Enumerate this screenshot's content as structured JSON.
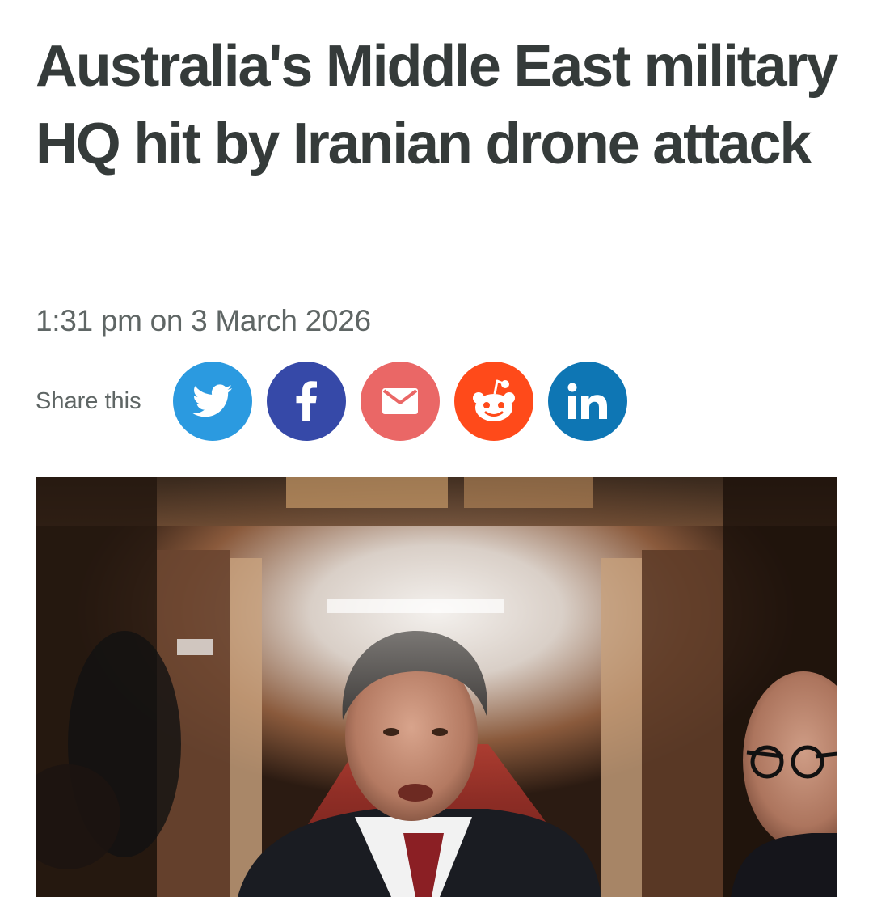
{
  "article": {
    "headline": "Australia's Middle East military HQ hit by Iranian drone attack",
    "timestamp": "1:31 pm on 3 March 2026"
  },
  "share": {
    "label": "Share this",
    "buttons": [
      {
        "network": "Twitter",
        "icon": "twitter-bird-icon",
        "color": "#2b9ae0"
      },
      {
        "network": "Facebook",
        "icon": "facebook-f-icon",
        "color": "#3649a8"
      },
      {
        "network": "Email",
        "icon": "envelope-icon",
        "color": "#ea6766"
      },
      {
        "network": "Reddit",
        "icon": "reddit-alien-icon",
        "color": "#ff4a1a"
      },
      {
        "network": "LinkedIn",
        "icon": "linkedin-in-icon",
        "color": "#0e76b4"
      }
    ]
  },
  "hero": {
    "description_icon": "photo"
  },
  "colors": {
    "headline": "#353b3a",
    "meta_text": "#5f6665",
    "background": "#ffffff"
  }
}
